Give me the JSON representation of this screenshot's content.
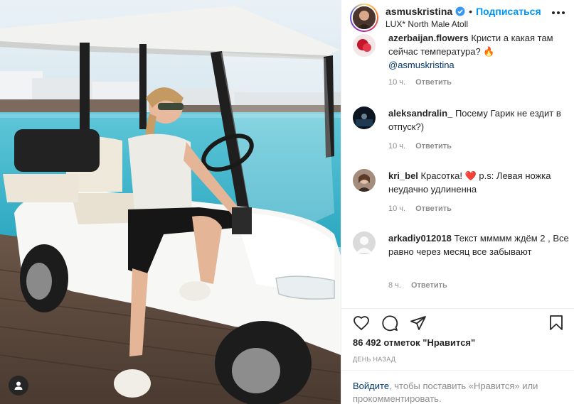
{
  "post": {
    "username": "asmuskristina",
    "separator": "•",
    "follow_label": "Подписаться",
    "location": "LUX* North Male Atoll"
  },
  "comments": [
    {
      "username": "azerbaijan.flowers",
      "text": "Кристи а какая там сейчас температура? 🔥",
      "mention": "@asmuskristina",
      "time": "10 ч.",
      "reply_label": "Ответить"
    },
    {
      "username": "aleksandralin_",
      "text": "Посему Гарик не ездит в отпуск?)",
      "time": "10 ч.",
      "reply_label": "Ответить"
    },
    {
      "username": "kri_bel",
      "text": "Красотка! ❤️ p.s: Левая ножка неудачно удлиненна",
      "time": "10 ч.",
      "reply_label": "Ответить"
    },
    {
      "username": "arkadiy012018",
      "text": "Текст ммммм ждём 2 , Все равно через месяц все забывают",
      "time": "8 ч.",
      "reply_label": "Ответить"
    }
  ],
  "likes_text": "86 492 отметок \"Нравится\"",
  "timestamp_text": "ДЕНЬ НАЗАД",
  "login": {
    "link": "Войдите",
    "rest": ", чтобы поставить «Нравится» или прокомментировать."
  },
  "icons": {
    "verified": "verified-badge-icon",
    "like": "heart-icon",
    "comment": "comment-bubble-icon",
    "share": "paper-plane-icon",
    "save": "bookmark-icon",
    "tag": "user-tag-icon",
    "more": "more-options-icon"
  },
  "colors": {
    "accent": "#0095f6",
    "text": "#262626",
    "muted": "#8e8e8e",
    "link": "#00376b"
  }
}
